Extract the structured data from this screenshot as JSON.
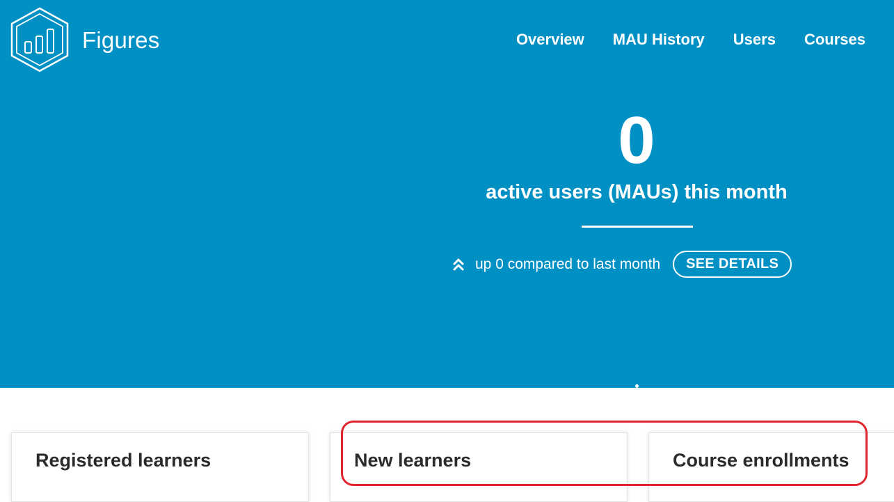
{
  "brand": {
    "name": "Figures",
    "logo_icon": "hexagon-bar-chart-logo"
  },
  "nav": {
    "items": [
      {
        "label": "Overview"
      },
      {
        "label": "MAU History"
      },
      {
        "label": "Users"
      },
      {
        "label": "Courses"
      }
    ]
  },
  "mau": {
    "value": "0",
    "label": "active users (MAUs) this month",
    "change_text": "up 0 compared to last month",
    "change_icon": "double-chevron-up-icon",
    "details_label": "SEE DETAILS"
  },
  "cards": [
    {
      "title": "Registered learners"
    },
    {
      "title": "New learners"
    },
    {
      "title": "Course enrollments"
    }
  ],
  "colors": {
    "hero_background": "#0090c4",
    "text_on_hero": "#ffffff",
    "card_title": "#2b2b2b",
    "highlight_outline": "#e0252f"
  }
}
